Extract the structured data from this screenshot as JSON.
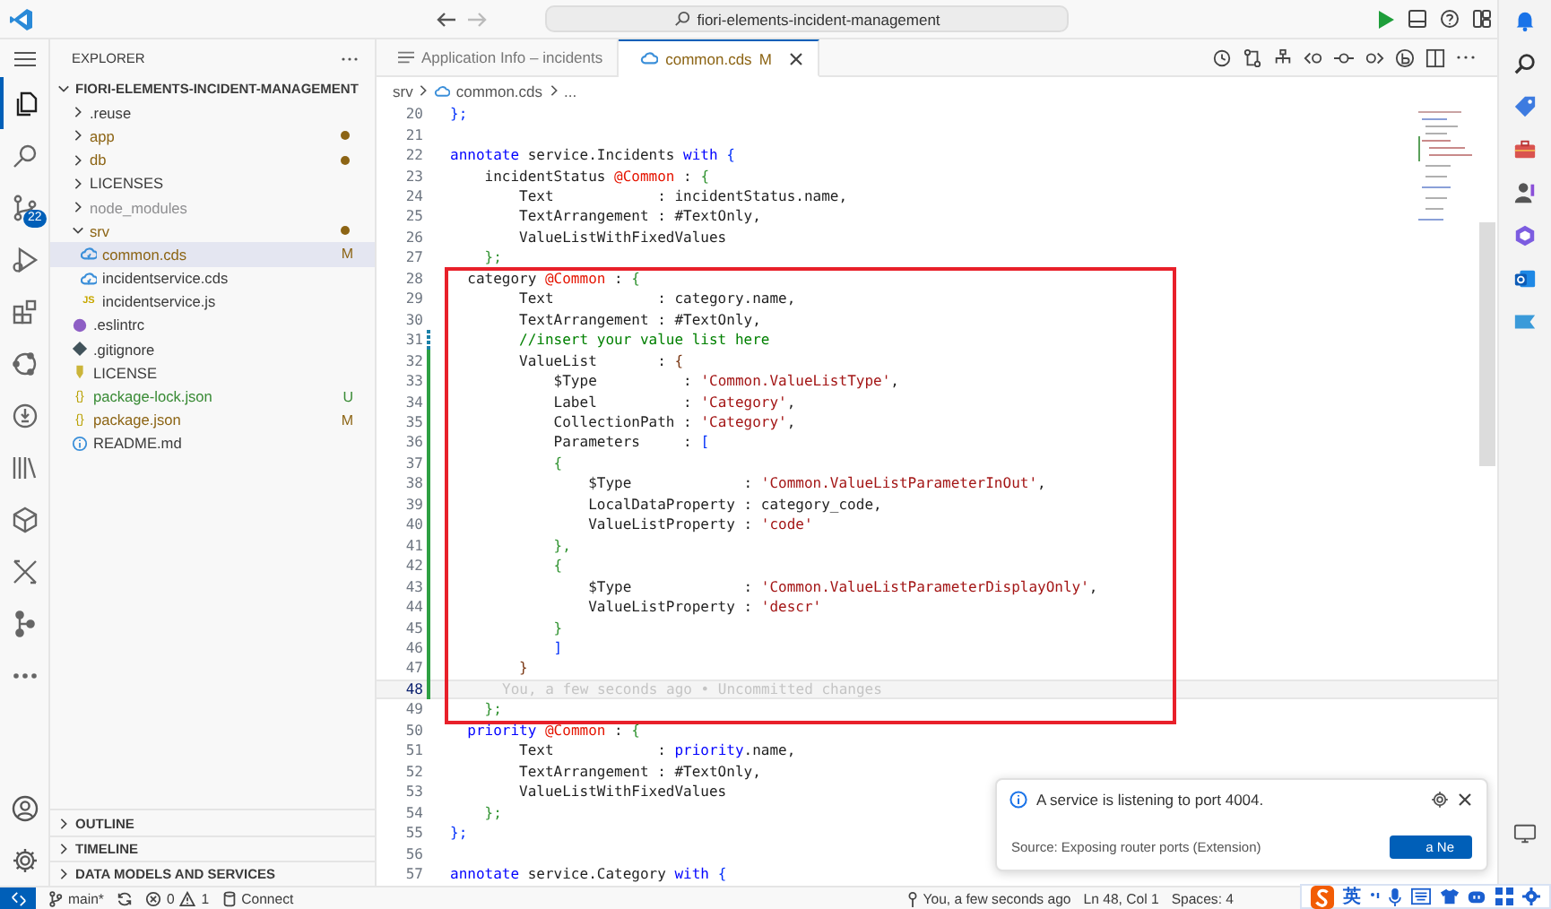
{
  "titlebar": {
    "search": "fiori-elements-incident-management",
    "back_enabled": true,
    "forward_enabled": false
  },
  "activity_bar": {
    "items": [
      {
        "kind": "files",
        "selected": true
      },
      {
        "kind": "search",
        "selected": false
      },
      {
        "kind": "branch",
        "selected": false,
        "badge": "22"
      },
      {
        "kind": "run",
        "selected": false
      },
      {
        "kind": "blocks",
        "selected": false
      },
      {
        "kind": "ring",
        "selected": false
      },
      {
        "kind": "circle-arrow",
        "selected": false
      },
      {
        "kind": "books",
        "selected": false
      },
      {
        "kind": "cube",
        "selected": false
      },
      {
        "kind": "tools",
        "selected": false
      },
      {
        "kind": "nodes",
        "selected": false
      },
      {
        "kind": "more",
        "selected": false
      }
    ]
  },
  "sidebar": {
    "title": "EXPLORER",
    "root": {
      "label": "FIORI-ELEMENTS-INCIDENT-MANAGEMENT",
      "expanded": true
    },
    "tree": [
      {
        "label": ".reuse",
        "kind": "folder",
        "expanded": false,
        "selected": false
      },
      {
        "label": "app",
        "kind": "folder",
        "expanded": false,
        "selected": false,
        "color": "#8c6414",
        "dot": true
      },
      {
        "label": "db",
        "kind": "folder",
        "expanded": false,
        "selected": false,
        "color": "#8c6414",
        "dot": true
      },
      {
        "label": "LICENSES",
        "kind": "folder",
        "expanded": false,
        "selected": false
      },
      {
        "label": "node_modules",
        "kind": "folder",
        "expanded": false,
        "selected": false,
        "color": "#8e8e90"
      },
      {
        "label": "srv",
        "kind": "folder",
        "expanded": true,
        "selected": false,
        "color": "#8c6414",
        "dot": true,
        "children": [
          {
            "label": "common.cds",
            "kind": "cds",
            "selected": true,
            "color": "#8c6414",
            "badge": "M"
          },
          {
            "label": "incidentservice.cds",
            "kind": "cds",
            "selected": false
          },
          {
            "label": "incidentservice.js",
            "kind": "js",
            "glyph": "JS",
            "selected": false
          }
        ]
      },
      {
        "label": ".eslintrc",
        "kind": "eslint",
        "selected": false
      },
      {
        "label": ".gitignore",
        "kind": "git",
        "selected": false
      },
      {
        "label": "LICENSE",
        "kind": "license",
        "selected": false
      },
      {
        "label": "package-lock.json",
        "kind": "json",
        "glyph": "{}",
        "selected": false,
        "color": "#388a34",
        "badge": "U"
      },
      {
        "label": "package.json",
        "kind": "json",
        "glyph": "{}",
        "selected": false,
        "color": "#8c6414",
        "badge": "M"
      },
      {
        "label": "README.md",
        "kind": "info",
        "selected": false
      }
    ],
    "sections": [
      {
        "label": "OUTLINE",
        "expanded": false
      },
      {
        "label": "TIMELINE",
        "expanded": false
      },
      {
        "label": "DATA MODELS AND SERVICES",
        "expanded": false
      }
    ]
  },
  "tabs": [
    {
      "label": "Application Info – incidents",
      "kind": "preview",
      "selected": false
    },
    {
      "label": "common.cds",
      "kind": "cds",
      "selected": true,
      "badge": "M"
    }
  ],
  "breadcrumb": [
    {
      "label": "srv",
      "kind": "folder"
    },
    {
      "label": "common.cds",
      "kind": "cds"
    },
    {
      "label": "...",
      "kind": "more"
    }
  ],
  "editor": {
    "lines": [
      {
        "n": "20",
        "code": [
          {
            "kind": "b2",
            "text": "};"
          }
        ]
      },
      {
        "n": "21"
      },
      {
        "n": "22",
        "code": [
          {
            "kind": "kw",
            "text": "annotate"
          },
          {
            "kind": "tx",
            "text": " service.Incidents "
          },
          {
            "kind": "kw",
            "text": "with"
          },
          {
            "kind": "b2",
            "text": " {"
          }
        ]
      },
      {
        "n": "23",
        "code": [
          {
            "kind": "tx",
            "text": "    incidentStatus "
          },
          {
            "kind": "dec",
            "text": "@Common"
          },
          {
            "kind": "tx",
            "text": " : "
          },
          {
            "kind": "b1",
            "text": "{"
          }
        ]
      },
      {
        "n": "24",
        "code": [
          {
            "kind": "tx",
            "text": "        Text            : incidentStatus.name,"
          }
        ]
      },
      {
        "n": "25",
        "code": [
          {
            "kind": "tx",
            "text": "        TextArrangement : #TextOnly,"
          }
        ]
      },
      {
        "n": "26",
        "code": [
          {
            "kind": "tx",
            "text": "        ValueListWithFixedValues"
          }
        ]
      },
      {
        "n": "27",
        "code": [
          {
            "kind": "b1",
            "text": "    };"
          }
        ]
      },
      {
        "n": "28",
        "boxed": true,
        "code": [
          {
            "kind": "tx",
            "text": "  category "
          },
          {
            "kind": "dec",
            "text": "@Common"
          },
          {
            "kind": "tx",
            "text": " : "
          },
          {
            "kind": "b1",
            "text": "{"
          }
        ]
      },
      {
        "n": "29",
        "boxed": true,
        "code": [
          {
            "kind": "tx",
            "text": "        Text            : category.name,"
          }
        ]
      },
      {
        "n": "30",
        "boxed": true,
        "code": [
          {
            "kind": "tx",
            "text": "        TextArrangement : #TextOnly,"
          }
        ]
      },
      {
        "n": "31",
        "boxed": true,
        "modified": true,
        "code": [
          {
            "kind": "cmt",
            "text": "        //insert your value list here"
          }
        ]
      },
      {
        "n": "32",
        "boxed": true,
        "added": true,
        "code": [
          {
            "kind": "tx",
            "text": "        ValueList       : "
          },
          {
            "kind": "b3",
            "text": "{"
          }
        ]
      },
      {
        "n": "33",
        "boxed": true,
        "added": true,
        "code": [
          {
            "kind": "tx",
            "text": "            $Type          : "
          },
          {
            "kind": "str",
            "text": "'Common.ValueListType'"
          },
          {
            "kind": "tx",
            "text": ","
          }
        ]
      },
      {
        "n": "34",
        "boxed": true,
        "added": true,
        "code": [
          {
            "kind": "tx",
            "text": "            Label          : "
          },
          {
            "kind": "str",
            "text": "'Category'"
          },
          {
            "kind": "tx",
            "text": ","
          }
        ]
      },
      {
        "n": "35",
        "boxed": true,
        "added": true,
        "code": [
          {
            "kind": "tx",
            "text": "            CollectionPath : "
          },
          {
            "kind": "str",
            "text": "'Category'"
          },
          {
            "kind": "tx",
            "text": ","
          }
        ]
      },
      {
        "n": "36",
        "boxed": true,
        "added": true,
        "code": [
          {
            "kind": "tx",
            "text": "            Parameters     : "
          },
          {
            "kind": "b2",
            "text": "["
          }
        ]
      },
      {
        "n": "37",
        "boxed": true,
        "added": true,
        "code": [
          {
            "kind": "b1",
            "text": "            {"
          }
        ]
      },
      {
        "n": "38",
        "boxed": true,
        "added": true,
        "code": [
          {
            "kind": "tx",
            "text": "                $Type             : "
          },
          {
            "kind": "str",
            "text": "'Common.ValueListParameterInOut'"
          },
          {
            "kind": "tx",
            "text": ","
          }
        ]
      },
      {
        "n": "39",
        "boxed": true,
        "added": true,
        "code": [
          {
            "kind": "tx",
            "text": "                LocalDataProperty : category_code,"
          }
        ]
      },
      {
        "n": "40",
        "boxed": true,
        "added": true,
        "code": [
          {
            "kind": "tx",
            "text": "                ValueListProperty : "
          },
          {
            "kind": "str",
            "text": "'code'"
          }
        ]
      },
      {
        "n": "41",
        "boxed": true,
        "added": true,
        "code": [
          {
            "kind": "b1",
            "text": "            },"
          }
        ]
      },
      {
        "n": "42",
        "boxed": true,
        "added": true,
        "code": [
          {
            "kind": "b1",
            "text": "            {"
          }
        ]
      },
      {
        "n": "43",
        "boxed": true,
        "added": true,
        "code": [
          {
            "kind": "tx",
            "text": "                $Type             : "
          },
          {
            "kind": "str",
            "text": "'Common.ValueListParameterDisplayOnly'"
          },
          {
            "kind": "tx",
            "text": ","
          }
        ]
      },
      {
        "n": "44",
        "boxed": true,
        "added": true,
        "code": [
          {
            "kind": "tx",
            "text": "                ValueListProperty : "
          },
          {
            "kind": "str",
            "text": "'descr'"
          }
        ]
      },
      {
        "n": "45",
        "boxed": true,
        "added": true,
        "code": [
          {
            "kind": "b1",
            "text": "            }"
          }
        ]
      },
      {
        "n": "46",
        "boxed": true,
        "added": true,
        "code": [
          {
            "kind": "b2",
            "text": "            ]"
          }
        ]
      },
      {
        "n": "47",
        "boxed": true,
        "added": true,
        "code": [
          {
            "kind": "b3",
            "text": "        }"
          }
        ]
      },
      {
        "n": "48",
        "boxed": true,
        "added": true,
        "current": true,
        "blame": "You, a few seconds ago • Uncommitted changes"
      },
      {
        "n": "49",
        "boxed": true,
        "code": [
          {
            "kind": "b1",
            "text": "    };"
          }
        ]
      },
      {
        "n": "50",
        "code": [
          {
            "kind": "kw",
            "text": "  priority"
          },
          {
            "kind": "dec",
            "text": " @Common"
          },
          {
            "kind": "tx",
            "text": " : "
          },
          {
            "kind": "b1",
            "text": "{"
          }
        ]
      },
      {
        "n": "51",
        "code": [
          {
            "kind": "tx",
            "text": "        Text            : "
          },
          {
            "kind": "kw",
            "text": "priority"
          },
          {
            "kind": "tx",
            "text": ".name,"
          }
        ]
      },
      {
        "n": "52",
        "code": [
          {
            "kind": "tx",
            "text": "        TextArrangement : #TextOnly,"
          }
        ]
      },
      {
        "n": "53",
        "code": [
          {
            "kind": "tx",
            "text": "        ValueListWithFixedValues"
          }
        ]
      },
      {
        "n": "54",
        "code": [
          {
            "kind": "b1",
            "text": "    };"
          }
        ]
      },
      {
        "n": "55",
        "code": [
          {
            "kind": "b2",
            "text": "};"
          }
        ]
      },
      {
        "n": "56"
      },
      {
        "n": "57",
        "code": [
          {
            "kind": "kw",
            "text": "annotate"
          },
          {
            "kind": "tx",
            "text": " service.Category "
          },
          {
            "kind": "kw",
            "text": "with"
          },
          {
            "kind": "b2",
            "text": " {"
          }
        ]
      }
    ]
  },
  "notification": {
    "message": "A service is listening to port 4004.",
    "source": "Source: Exposing router ports (Extension)",
    "button": "a Ne"
  },
  "status_bar": {
    "branch": "main*",
    "errors": "0",
    "warnings": "1",
    "connect": "Connect",
    "blame": "You, a few seconds ago",
    "position": "Ln 48, Col 1",
    "spaces": "Spaces: 4"
  },
  "ime": {
    "lang": "英"
  }
}
